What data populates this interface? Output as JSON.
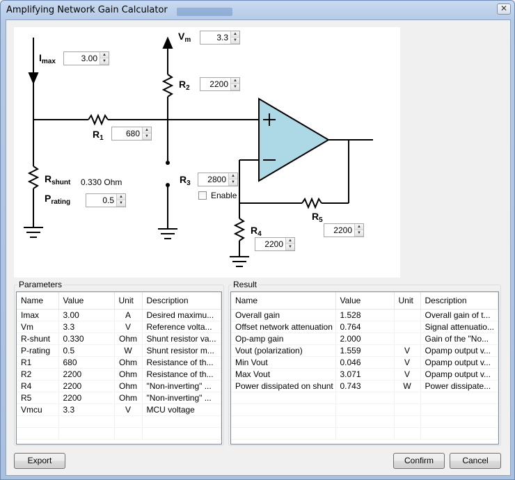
{
  "window": {
    "title": "Amplifying Network Gain Calculator",
    "close_glyph": "✕"
  },
  "circuit": {
    "imax": {
      "label": "I",
      "sub": "max",
      "value": "3.00"
    },
    "vm": {
      "label": "V",
      "sub": "m",
      "value": "3.3"
    },
    "r2": {
      "label": "R",
      "sub": "2",
      "value": "2200"
    },
    "r1": {
      "label": "R",
      "sub": "1",
      "value": "680"
    },
    "rshunt": {
      "label": "R",
      "sub": "shunt",
      "value_text": "0.330 Ohm"
    },
    "prating": {
      "label": "P",
      "sub": "rating",
      "value": "0.5"
    },
    "r3": {
      "label": "R",
      "sub": "3",
      "value": "2800",
      "enable_label": "Enable",
      "enabled": false
    },
    "r5": {
      "label": "R",
      "sub": "5",
      "value": "2200"
    },
    "r4": {
      "label": "R",
      "sub": "4",
      "value": "2200"
    },
    "colors": {
      "opamp_fill": "#add8e6",
      "wire": "#000000"
    }
  },
  "parameters": {
    "title": "Parameters",
    "columns": [
      "Name",
      "Value",
      "Unit",
      "Description"
    ],
    "rows": [
      [
        "Imax",
        "3.00",
        "A",
        "Desired maximu..."
      ],
      [
        "Vm",
        "3.3",
        "V",
        "Reference volta..."
      ],
      [
        "R-shunt",
        "0.330",
        "Ohm",
        "Shunt resistor va..."
      ],
      [
        "P-rating",
        "0.5",
        "W",
        "Shunt resistor m..."
      ],
      [
        "R1",
        "680",
        "Ohm",
        "Resistance of th..."
      ],
      [
        "R2",
        "2200",
        "Ohm",
        "Resistance of th..."
      ],
      [
        "R4",
        "2200",
        "Ohm",
        "\"Non-inverting\" ..."
      ],
      [
        "R5",
        "2200",
        "Ohm",
        "\"Non-inverting\" ..."
      ],
      [
        "Vmcu",
        "3.3",
        "V",
        "MCU voltage"
      ]
    ]
  },
  "result": {
    "title": "Result",
    "columns": [
      "Name",
      "Value",
      "Unit",
      "Description"
    ],
    "rows": [
      [
        "Overall gain",
        "1.528",
        "",
        "Overall gain of t..."
      ],
      [
        "Offset network attenuation",
        "0.764",
        "",
        "Signal attenuatio..."
      ],
      [
        "Op-amp gain",
        "2.000",
        "",
        "Gain of the \"No..."
      ],
      [
        "Vout (polarization)",
        "1.559",
        "V",
        "Opamp output v..."
      ],
      [
        "Min Vout",
        "0.046",
        "V",
        "Opamp output v..."
      ],
      [
        "Max Vout",
        "3.071",
        "V",
        "Opamp output v..."
      ],
      [
        "Power dissipated on shunt",
        "0.743",
        "W",
        "Power dissipate..."
      ]
    ]
  },
  "buttons": {
    "export": "Export",
    "confirm": "Confirm",
    "cancel": "Cancel"
  }
}
